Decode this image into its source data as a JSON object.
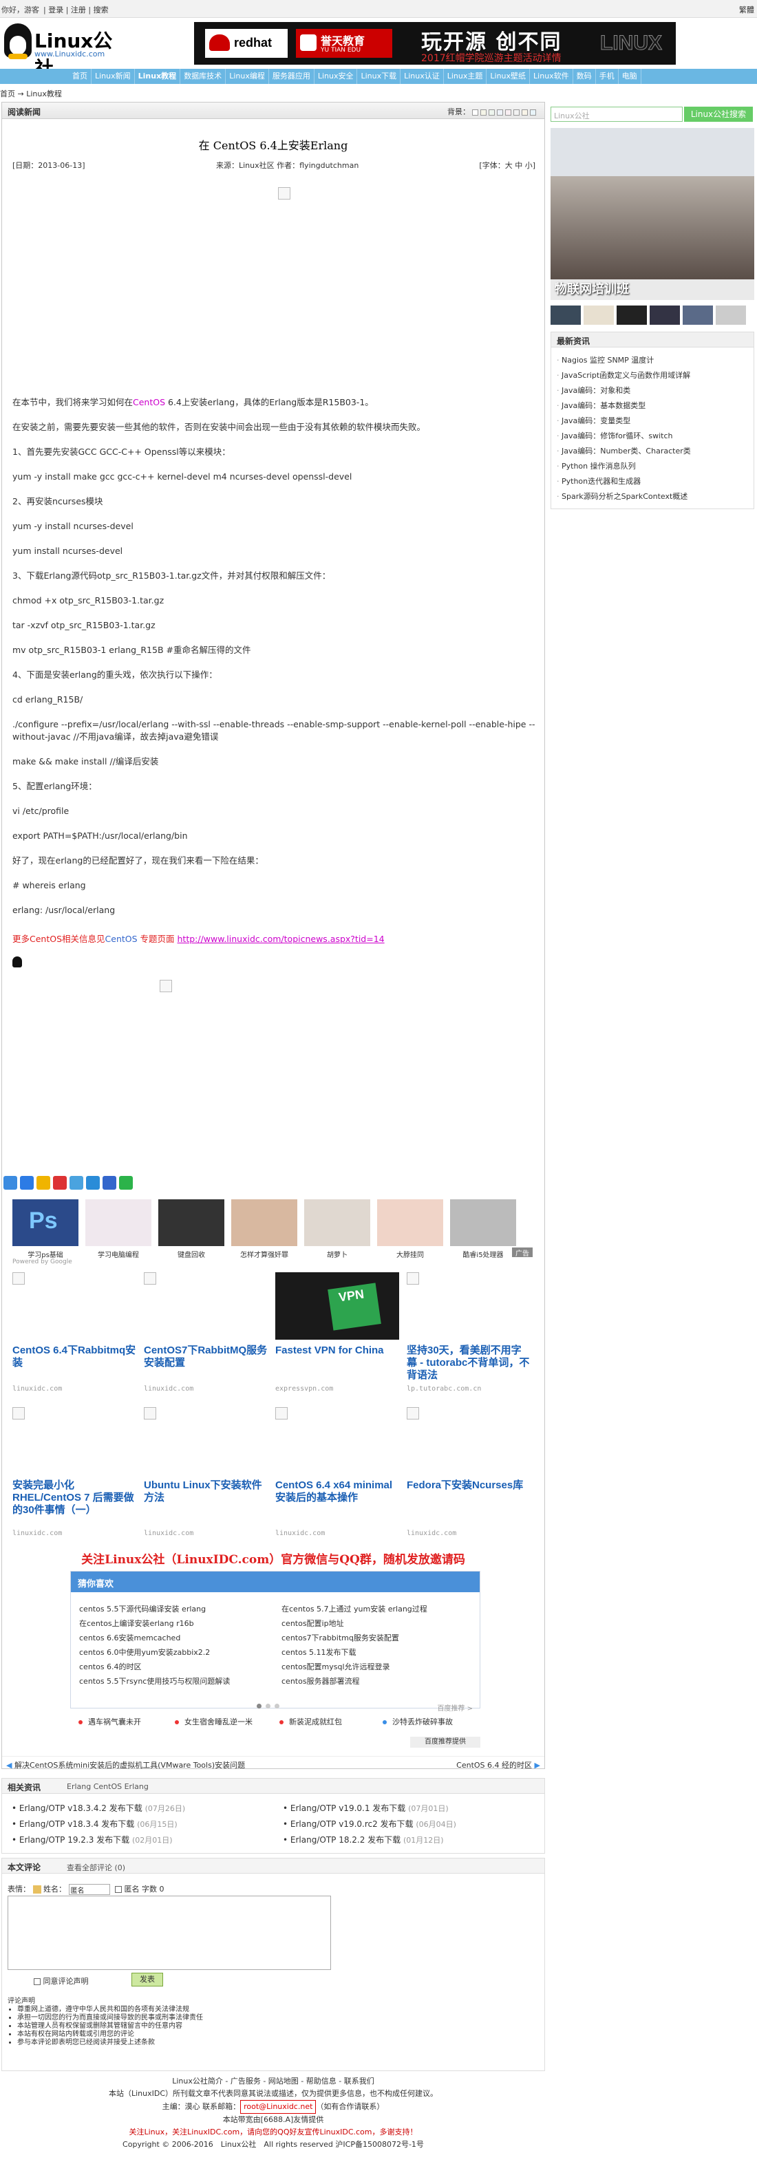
{
  "topbar": {
    "links": [
      "你好，游客",
      "登录",
      "注册",
      "搜索"
    ],
    "right": "繁體"
  },
  "logo": {
    "name": "Linux公社",
    "url": "www.Linuxidc.com"
  },
  "banner": {
    "redhat": "redhat",
    "yutian": "誉天教育",
    "yutian_en": "YU TIAN EDU",
    "slogan": "玩开源 创不同",
    "sub": "2017红帽学院巡游主题活动详情",
    "linux": "LINUX"
  },
  "nav": [
    "首页",
    "Linux新闻",
    "Linux教程",
    "数据库技术",
    "Linux编程",
    "服务器应用",
    "Linux安全",
    "Linux下载",
    "Linux认证",
    "Linux主题",
    "Linux壁纸",
    "Linux软件",
    "数码",
    "手机",
    "电脑"
  ],
  "breadcrumb": "首页 → Linux教程",
  "panel": {
    "title": "阅读新闻",
    "bg_label": "背景："
  },
  "article": {
    "title": "在 CentOS 6.4上安装Erlang",
    "date": "[日期：2013-06-13]",
    "source": "来源：Linux社区  作者：flyingdutchman",
    "font": "[字体：大 中 小]",
    "p1a": "在本节中，我们将来学习如何在",
    "p1link": "CentOS",
    "p1b": " 6.4上安装erlang，具体的Erlang版本是R15B03-1。",
    "lines": [
      "在安装之前，需要先要安装一些其他的软件，否则在安装中间会出现一些由于没有其依赖的软件模块而失败。",
      "1、首先要先安装GCC GCC-C++ Openssl等以来模块：",
      "yum -y install make gcc gcc-c++ kernel-devel m4 ncurses-devel openssl-devel",
      "2、再安装ncurses模块",
      "yum -y install ncurses-devel",
      "yum install ncurses-devel",
      "3、下载Erlang源代码otp_src_R15B03-1.tar.gz文件，并对其付权限和解压文件：",
      "chmod +x otp_src_R15B03-1.tar.gz",
      "tar -xzvf otp_src_R15B03-1.tar.gz",
      "mv otp_src_R15B03-1 erlang_R15B #重命名解压得的文件",
      "4、下面是安装erlang的重头戏，依次执行以下操作：",
      "cd erlang_R15B/",
      "./configure --prefix=/usr/local/erlang --with-ssl --enable-threads --enable-smp-support --enable-kernel-poll --enable-hipe --without-javac  //不用java编译，故去掉java避免错误",
      "make && make install //编译后安装",
      "5、配置erlang环境：",
      "vi /etc/profile",
      "export PATH=$PATH:/usr/local/erlang/bin",
      "好了，现在erlang的已经配置好了，现在我们来看一下险在结果：",
      "# whereis erlang",
      "erlang: /usr/local/erlang"
    ],
    "more_prefix": "更多CentOS相关信息见",
    "more_link": "CentOS",
    "more_mid": " 专题页面 ",
    "more_url": "http://www.linuxidc.com/topicnews.aspx?tid=14"
  },
  "ads": {
    "items": [
      "学习ps基础",
      "学习电脑编程",
      "键盘回收",
      "怎样才算强奸罪",
      "胡萝卜",
      "大脖挂同",
      "酷睿i5处理器"
    ],
    "powered": "Powered by Google",
    "tag": "广告"
  },
  "recommend": [
    {
      "title": "CentOS 6.4下Rabbitmq安装",
      "src": "linuxidc.com"
    },
    {
      "title": "CentOS7下RabbitMQ服务安装配置",
      "src": "linuxidc.com"
    },
    {
      "title": "Fastest VPN for China",
      "src": "expressvpn.com"
    },
    {
      "title": "坚持30天，看美剧不用字幕 - tutorabc不背单词，不背语法",
      "src": "lp.tutorabc.com.cn"
    },
    {
      "title": "安装完最小化 RHEL/CentOS 7 后需要做的30件事情（一）",
      "src": "linuxidc.com"
    },
    {
      "title": "Ubuntu Linux下安装软件方法",
      "src": "linuxidc.com"
    },
    {
      "title": "CentOS 6.4 x64 minimal安装后的基本操作",
      "src": "linuxidc.com"
    },
    {
      "title": "Fedora下安装Ncurses库",
      "src": "linuxidc.com"
    }
  ],
  "wechat": "关注Linux公社（LinuxIDC.com）官方微信与QQ群，随机发放邀请码",
  "like": {
    "title": "猜你喜欢",
    "left": [
      "centos 5.5下源代码编译安装 erlang",
      "在centos上编译安装erlang r16b",
      "centos 6.6安装memcached",
      "centos 6.0中使用yum安装zabbix2.2",
      "centos 6.4的时区",
      "centos 5.5下rsync使用技巧与权限问题解读"
    ],
    "right": [
      "在centos 5.7上通过 yum安装 erlang过程",
      "centos配置ip地址",
      "centos7下rabbitmq服务安装配置",
      "centos 5.11发布下载",
      "centos配置mysql允许远程登录",
      "centos服务器部署流程"
    ],
    "more": "百度推荐 >",
    "hot": [
      "遇车祸气囊未开",
      "女生宿舍睡乱逆一米",
      "新装泥成就红包",
      "沙特丢炸破碎事故"
    ],
    "baidu": "百度推荐提供"
  },
  "prevnext": {
    "prev": "解决CentOS系统mini安装后的虚拟机工具(VMware Tools)安装问题",
    "next": "CentOS 6.4 经的时区"
  },
  "related": {
    "title": "相关资讯",
    "tags": "Erlang   CentOS Erlang",
    "left": [
      [
        "Erlang/OTP v18.3.4.2 发布下载",
        "(07月26日)"
      ],
      [
        "Erlang/OTP v18.3.4 发布下载",
        "(06月15日)"
      ],
      [
        "Erlang/OTP 19.2.3 发布下载",
        "(02月01日)"
      ]
    ],
    "right": [
      [
        "Erlang/OTP v19.0.1 发布下载",
        "(07月01日)"
      ],
      [
        "Erlang/OTP v19.0.rc2 发布下载",
        "(06月04日)"
      ],
      [
        "Erlang/OTP 18.2.2 发布下载",
        "(01月12日)"
      ]
    ]
  },
  "comment": {
    "title": "本文评论",
    "view_all": "查看全部评论 (0)",
    "label": "表情：",
    "name_label": "姓名：",
    "name_value": "匿名",
    "anon": "匿名 字数 0",
    "agree": "同意评论声明",
    "send": "发表",
    "rules_title": "评论声明",
    "rules": [
      "尊重网上道德，遵守中华人民共和国的各项有关法律法规",
      "承担一切因您的行为而直接或间接导致的民事或刑事法律责任",
      "本站管理人员有权保留或删除其管辖留言中的任意内容",
      "本站有权在网站内转载或引用您的评论",
      "参与本评论即表明您已经阅读并接受上述条款"
    ]
  },
  "footer": {
    "line1": "Linux公社简介 - 广告服务 - 网站地图 - 帮助信息 - 联系我们",
    "line2": "本站（LinuxIDC）所刊载文章不代表同意其说法或描述，仅为提供更多信息，也不构成任何建议。",
    "line3a": "主编：漠心   联系邮箱：",
    "email": "root@Linuxidc.net",
    "line3b": "（如有合作请联系）",
    "line4": "本站带宽由[6688.A]友情提供",
    "line5": "关注Linux，关注LinuxIDC.com，请向您的QQ好友宣传LinuxIDC.com，多谢支持！",
    "line6": "Copyright © 2006-2016　Linux公社　All rights reserved 沪ICP备15008072号-1号"
  },
  "sidebar": {
    "search_placeholder": "Linux公社",
    "search_button": "Linux公社搜索",
    "photo_caption": "物联网培训班",
    "latest_title": "最新资讯",
    "latest": [
      "Nagios 监控 SNMP 温度计",
      "JavaScript函数定义与函数作用域详解",
      "Java编码：对象和类",
      "Java编码：基本数据类型",
      "Java编码：变量类型",
      "Java编码：修饰for循环、switch",
      "Java编码：Number类、Character类",
      "Python 操作消息队列",
      "Python迭代器和生成器",
      "Spark源码分析之SparkContext概述"
    ]
  }
}
